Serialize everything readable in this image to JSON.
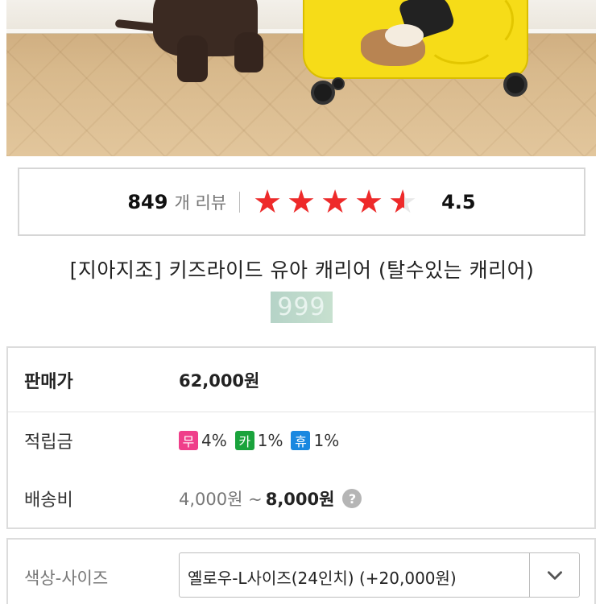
{
  "review": {
    "count": "849",
    "unit": "개 리뷰",
    "rating": "4.5",
    "rating_value": 4.5,
    "max_rating": 5,
    "star_color": "#ee2a2a"
  },
  "product": {
    "title": "[지아지조] 키즈라이드 유아 캐리어 (탈수있는 캐리어)",
    "code_chip": "999"
  },
  "info": {
    "price_label": "판매가",
    "price_value": "62,000원",
    "points_label": "적립금",
    "points": [
      {
        "badge": "무",
        "rate": "4%",
        "color": "#ef3f8a"
      },
      {
        "badge": "카",
        "rate": "1%",
        "color": "#1aa33c"
      },
      {
        "badge": "휴",
        "rate": "1%",
        "color": "#1a88e0"
      }
    ],
    "shipping_label": "배송비",
    "shipping_min": "4,000원 ~",
    "shipping_max": "8,000원",
    "help_icon": "?"
  },
  "option": {
    "label": "색상-사이즈",
    "selected": "옐로우-L사이즈(24인치) (+20,000원)"
  }
}
